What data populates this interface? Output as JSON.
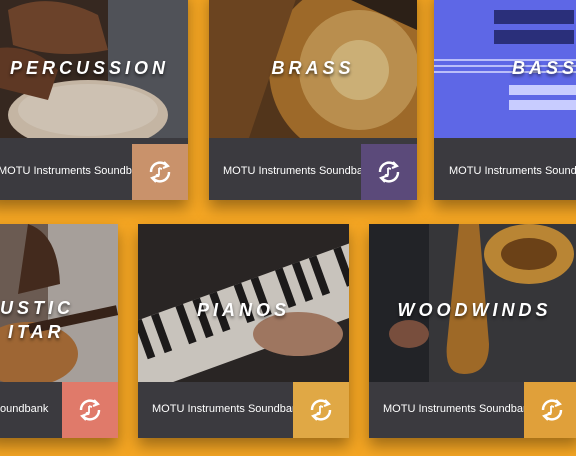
{
  "tiles": [
    {
      "title": "PERCUSSION",
      "subtitle": "MOTU Instruments Soundbank",
      "accent": "#c9926b"
    },
    {
      "title": "BRASS",
      "subtitle": "MOTU Instruments Soundbank",
      "accent": "#5b4a7a"
    },
    {
      "title": "BASS",
      "subtitle": "MOTU Instruments Soundbank",
      "accent": "#5a63d8"
    },
    {
      "title": "ACOUSTIC GUITAR",
      "title_visible": "USTIC",
      "title_visible2": "ITAR",
      "subtitle": "oundbank",
      "accent": "#e07a6a"
    },
    {
      "title": "PIANOS",
      "subtitle": "MOTU Instruments Soundbank",
      "accent": "#e0a845"
    },
    {
      "title": "WOODWINDS",
      "subtitle": "MOTU Instruments Soundbank",
      "accent": "#e0a03a"
    }
  ],
  "icon": "music-loop-icon",
  "background_color": "#f5a623"
}
